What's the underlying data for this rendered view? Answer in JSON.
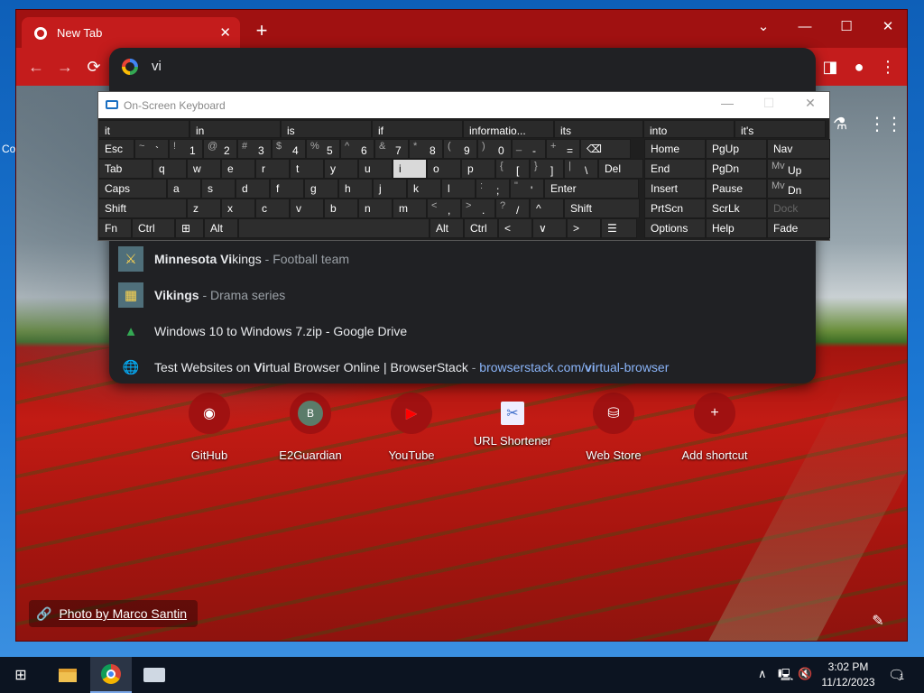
{
  "desktop": {
    "label": "Co"
  },
  "browser": {
    "tab_title": "New Tab",
    "tab_close": "✕",
    "new_tab": "+",
    "window_controls": {
      "dropdown": "⌄",
      "minimize": "—",
      "maximize": "☐",
      "close": "✕"
    },
    "nav": {
      "back": "←",
      "forward": "→",
      "reload": "⟳"
    },
    "toolbar_icons": {
      "sidebar": "◨",
      "profile": "●",
      "menu": "⋮"
    }
  },
  "omnibox": {
    "query": "vi",
    "suggestions": [
      {
        "icon": "vikings-logo",
        "parts": [
          {
            "t": "Minnesota Vi",
            "b": true
          },
          {
            "t": "kings",
            "b": false
          },
          {
            "t": " - Football team",
            "dim": true
          }
        ]
      },
      {
        "icon": "vikings-image",
        "parts": [
          {
            "t": "Vi",
            "b": true
          },
          {
            "t": "kings",
            "b": true
          },
          {
            "t": " - Drama series",
            "dim": true
          }
        ]
      },
      {
        "icon": "google-drive-icon",
        "parts": [
          {
            "t": "Windows 10 to Windows 7.zip - Google Drive",
            "b": false
          }
        ]
      },
      {
        "icon": "globe-icon",
        "parts": [
          {
            "t": "Test Websites on ",
            "b": false
          },
          {
            "t": "Vi",
            "b": true
          },
          {
            "t": "rtual Browser Online | BrowserStack",
            "b": false
          },
          {
            "t": " - ",
            "dim": true
          },
          {
            "t": "browserstack.com/",
            "url": true
          },
          {
            "t": "vi",
            "url": true,
            "b": true
          },
          {
            "t": "rtual-browser",
            "url": true
          }
        ]
      }
    ]
  },
  "ntp": {
    "shortcuts": [
      {
        "label": "GitHub",
        "icon": "github-icon",
        "glyph": "◉"
      },
      {
        "label": "E2Guardian",
        "icon": "letter-b-icon",
        "glyph": "B"
      },
      {
        "label": "YouTube",
        "icon": "youtube-icon",
        "glyph": "▶"
      },
      {
        "label": "URL Shortener",
        "icon": "url-shortener-icon",
        "glyph": "✂"
      },
      {
        "label": "Web Store",
        "icon": "web-store-icon",
        "glyph": "⛁"
      },
      {
        "label": "Add shortcut",
        "icon": "plus-icon",
        "glyph": "+"
      }
    ],
    "photo_credit": "Photo by Marco Santin",
    "labs_glyph": "⚗",
    "apps_glyph": "⋮⋮⋮",
    "edit_glyph": "✎"
  },
  "osk": {
    "title": "On-Screen Keyboard",
    "title_buttons": {
      "minimize": "—",
      "maximize": "☐",
      "close": "✕"
    },
    "predictions": [
      "it",
      "in",
      "is",
      "if",
      "informatio...",
      "its",
      "into",
      "it's"
    ],
    "rows": [
      {
        "keys": [
          "Esc",
          "~ `",
          "! 1",
          "@ 2",
          "# 3",
          "$ 4",
          "% 5",
          "^ 6",
          "& 7",
          "* 8",
          "( 9",
          ") 0",
          "_ -",
          "+ =",
          "⌫"
        ]
      },
      {
        "keys": [
          "Tab",
          "q",
          "w",
          "e",
          "r",
          "t",
          "y",
          "u",
          "i",
          "o",
          "p",
          "{ [",
          "} ]",
          "| \\",
          "Del"
        ]
      },
      {
        "keys": [
          "Caps",
          "a",
          "s",
          "d",
          "f",
          "g",
          "h",
          "j",
          "k",
          "l",
          ": ;",
          "\" '",
          "Enter"
        ]
      },
      {
        "keys": [
          "Shift",
          "z",
          "x",
          "c",
          "v",
          "b",
          "n",
          "m",
          "< ,",
          "> .",
          "? /",
          "^",
          "Shift"
        ]
      },
      {
        "keys": [
          "Fn",
          "Ctrl",
          "⊞",
          "Alt",
          "",
          "Alt",
          "Ctrl",
          "<",
          "∨",
          ">",
          "☰"
        ]
      }
    ],
    "side": [
      [
        "Home",
        "PgUp",
        "Nav"
      ],
      [
        "End",
        "PgDn",
        "Mv Up"
      ],
      [
        "Insert",
        "Pause",
        "Mv Dn"
      ],
      [
        "PrtScn",
        "ScrLk",
        "Dock"
      ],
      [
        "Options",
        "Help",
        "Fade"
      ]
    ]
  },
  "taskbar": {
    "start_glyph": "⊞",
    "time": "3:02 PM",
    "date": "11/12/2023",
    "tray": {
      "chevron": "∧",
      "network": "🖳",
      "volume": "🔇",
      "notifications": "🗨",
      "badge": "1"
    }
  }
}
